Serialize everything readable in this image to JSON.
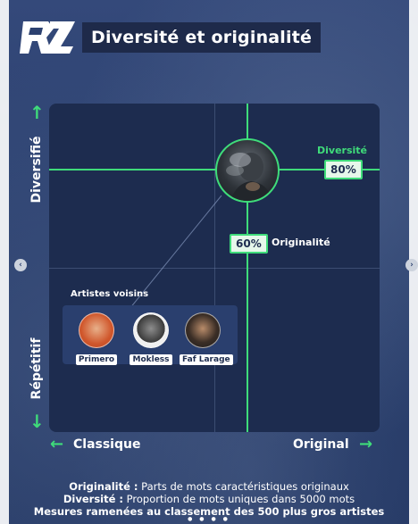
{
  "header": {
    "logo_text": "RZ",
    "title": "Diversité et originalité"
  },
  "axes": {
    "y_top": "Diversifié",
    "y_bottom": "Répétitif",
    "x_left": "Classique",
    "x_right": "Original",
    "arrow_up": "↑",
    "arrow_down": "↓",
    "arrow_left": "←",
    "arrow_right": "→"
  },
  "chart_data": {
    "type": "scatter",
    "title": "Diversité et originalité",
    "xlabel": "Originalité",
    "ylabel": "Diversité",
    "xlim": [
      0,
      100
    ],
    "ylim": [
      0,
      100
    ],
    "points": [
      {
        "x": 60,
        "y": 80
      }
    ],
    "annotations": {
      "diversity_label": "Diversité",
      "diversity_value": "80%",
      "originality_label": "Originalité",
      "originality_value": "60%"
    },
    "grid": true
  },
  "neighbors": {
    "title": "Artistes voisins",
    "items": [
      {
        "name": "Primero"
      },
      {
        "name": "Mokless"
      },
      {
        "name": "Faf Larage"
      }
    ]
  },
  "footer": {
    "line1_bold": "Originalité :",
    "line1_text": " Parts de mots caractéristiques originaux",
    "line2_bold": "Diversité :",
    "line2_text": " Proportion de mots uniques dans 5000 mots",
    "line3": "Mesures ramenées au classement des 500 plus gros artistes"
  },
  "nav": {
    "prev": "‹",
    "next": "›"
  },
  "colors": {
    "accent": "#3fdc7a",
    "background": "#2c4170",
    "plot": "#1d2c4f"
  }
}
